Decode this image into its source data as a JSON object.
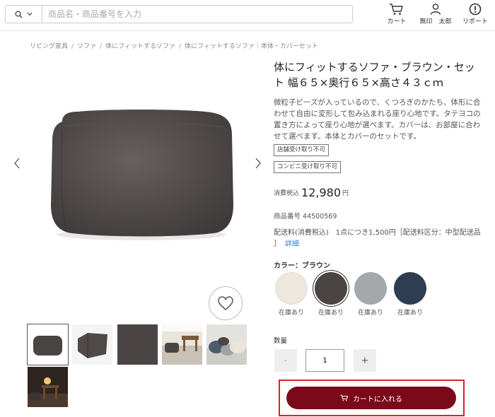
{
  "header": {
    "search_placeholder": "商品名・商品番号を入力",
    "cart_label": "カート",
    "user_label": "無印　太郎",
    "support_label": "リポート"
  },
  "breadcrumb": [
    "リビング家具",
    "ソファ",
    "体にフィットするソファ",
    "体にフィットするソファ｜本体・カバーセット"
  ],
  "product": {
    "title": "体にフィットするソファ・ブラウン・セット 幅６５×奥行６５×高さ４３ｃｍ",
    "description": "微粒子ビーズが入っているので、くつろぎのかたち、体形に合わせて自由に変形して包み込まれる座り心地です。タテヨコの置き方によって座り心地が選べます。カバーは、お部屋に合わせて選べます。本体とカバーのセットです。",
    "tags": [
      "店舗受け取り不可",
      "コンビニ受け取り不可"
    ],
    "price_label": "消費税込",
    "price": "12,980",
    "price_unit": "円",
    "product_number": "商品番号 44500569",
    "shipping": "配送料(消費税込)　1点につき1,500円［配送料区分：中型配送品 ］",
    "shipping_link": "詳細",
    "color_label": "カラー：ブラウン",
    "colors": [
      {
        "name": "ivory",
        "hex": "#eee7de",
        "stock": "在庫あり"
      },
      {
        "name": "brown",
        "hex": "#4a4443",
        "stock": "在庫あり"
      },
      {
        "name": "gray",
        "hex": "#a4a8ab",
        "stock": "在庫あり"
      },
      {
        "name": "navy",
        "hex": "#2f3d52",
        "stock": "在庫あり"
      }
    ],
    "quantity_label": "数量",
    "quantity": "1",
    "minus": "-",
    "plus": "+",
    "cart_button": "カートに入れる"
  },
  "colors": {
    "accent": "#7a0a1a",
    "highlight": "#e02020",
    "link": "#3a7bd5"
  }
}
